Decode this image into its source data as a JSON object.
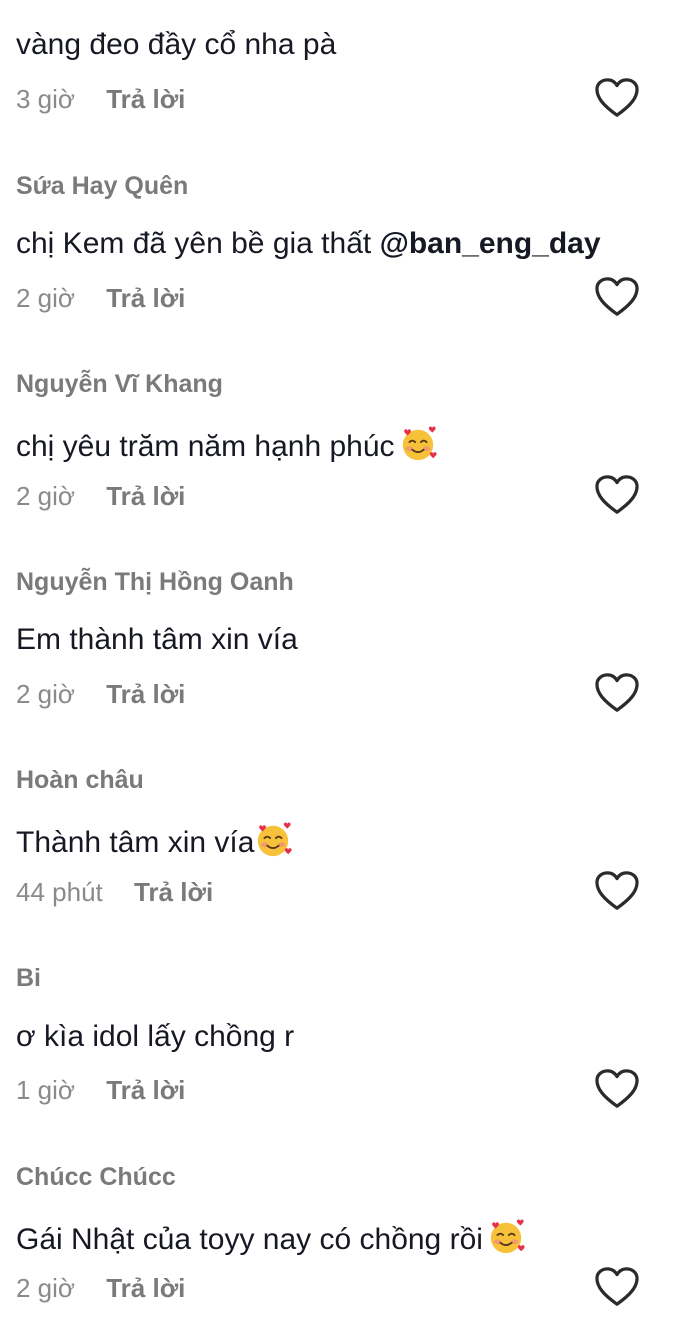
{
  "comments": [
    {
      "username": "",
      "text": "vàng đeo đầy cổ nha pà",
      "mention": "",
      "emoji": "",
      "time": "3 giờ",
      "reply_label": "Trả lời",
      "like_icon": "heart-outline-icon"
    },
    {
      "username": "Sứa Hay Quên",
      "text": "chị Kem đã yên bề gia thất ",
      "mention": "@ban_eng_day",
      "emoji": "",
      "time": "2 giờ",
      "reply_label": "Trả lời",
      "like_icon": "heart-outline-icon"
    },
    {
      "username": "Nguyễn Vĩ Khang",
      "text": "chị yêu trăm năm hạnh phúc",
      "mention": "",
      "emoji": "smiling-face-with-hearts",
      "time": "2 giờ",
      "reply_label": "Trả lời",
      "like_icon": "heart-outline-icon"
    },
    {
      "username": "Nguyễn Thị Hồng Oanh",
      "text": "Em thành tâm xin vía",
      "mention": "",
      "emoji": "",
      "time": "2 giờ",
      "reply_label": "Trả lời",
      "like_icon": "heart-outline-icon"
    },
    {
      "username": "Hoàn châu",
      "text": "Thành tâm xin vía",
      "mention": "",
      "emoji": "smiling-face-with-hearts",
      "time": "44 phút",
      "reply_label": "Trả lời",
      "like_icon": "heart-outline-icon"
    },
    {
      "username": "Bi",
      "text": "ơ kìa idol lấy chồng r",
      "mention": "",
      "emoji": "",
      "time": "1 giờ",
      "reply_label": "Trả lời",
      "like_icon": "heart-outline-icon"
    },
    {
      "username": "Chúcc Chúcc",
      "text": "Gái Nhật của toyy nay có chồng rồi",
      "mention": "",
      "emoji": "smiling-face-with-hearts",
      "time": "2 giờ",
      "reply_label": "Trả lời",
      "like_icon": "heart-outline-icon"
    }
  ],
  "colors": {
    "text": "#161823",
    "username": "#7a7a7d",
    "meta": "#8a8a8d",
    "heart_stroke": "#2b2b2b"
  }
}
